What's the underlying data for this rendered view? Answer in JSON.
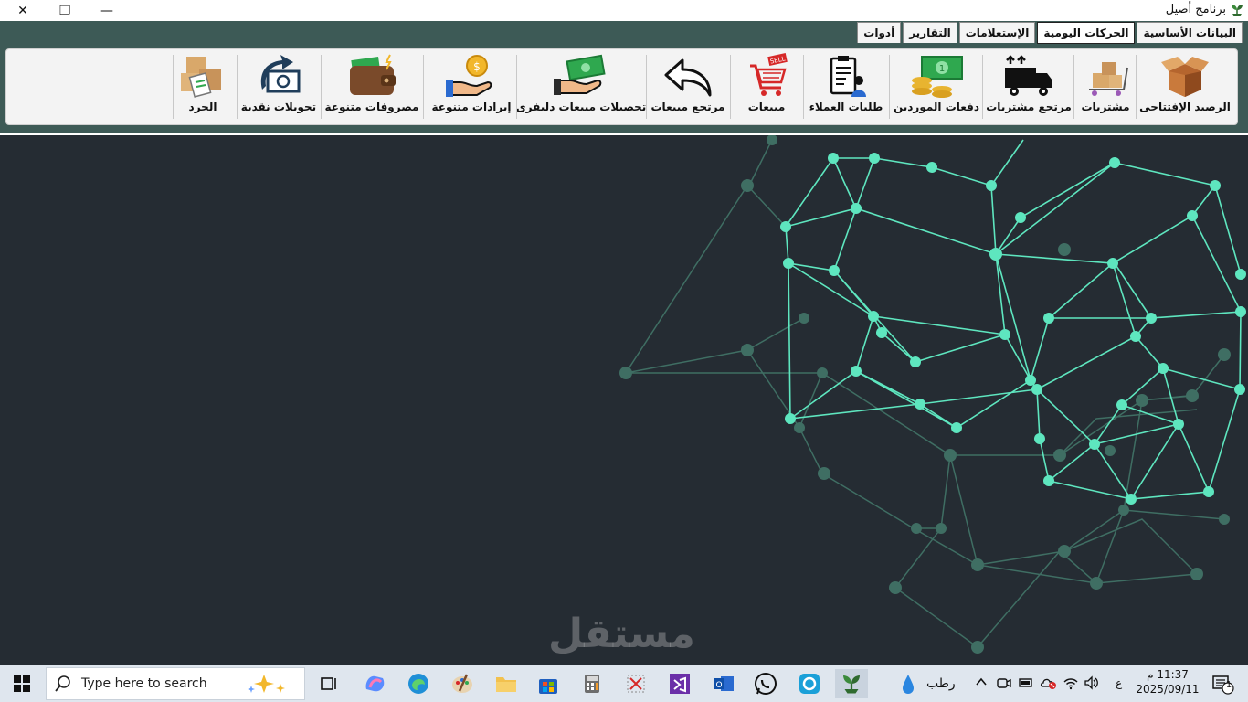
{
  "window": {
    "title": "برنامج أصيل",
    "controls": {
      "close": "✕",
      "maximize": "❐",
      "minimize": "—"
    }
  },
  "menu": {
    "tabs": [
      {
        "label": "البيانات الأساسية",
        "active": false
      },
      {
        "label": "الحركات اليومية",
        "active": true
      },
      {
        "label": "الإستعلامات",
        "active": false
      },
      {
        "label": "التقارير",
        "active": false
      },
      {
        "label": "أدوات",
        "active": false
      }
    ]
  },
  "toolbar": {
    "opening_balance": "الرصيد الإفتتاحى",
    "purchases": "مشتريات",
    "purchase_returns": "مرتجع مشتريات",
    "supplier_payments": "دفعات الموردين",
    "customer_orders": "طلبات العملاء",
    "sales": "مبيعات",
    "sales_returns": "مرتجع مبيعات",
    "delivery_collections": "تحصيلات مبيعات دليفرى",
    "misc_revenues": "إيرادات متنوعة",
    "misc_expenses": "مصروفات متنوعة",
    "cash_transfers": "تحويلات نقدية",
    "inventory": "الجرد"
  },
  "watermark": "مستقل",
  "taskbar": {
    "search_placeholder": "Type here to search",
    "weather": "رطب",
    "lang": "ع",
    "time": "11:37 م",
    "date": "2025/09/11",
    "notifications": "1"
  },
  "colors": {
    "accent": "#3d5a56",
    "background": "#252c33",
    "network_bright": "#5ee6bf",
    "network_dim": "#3f6e63"
  }
}
